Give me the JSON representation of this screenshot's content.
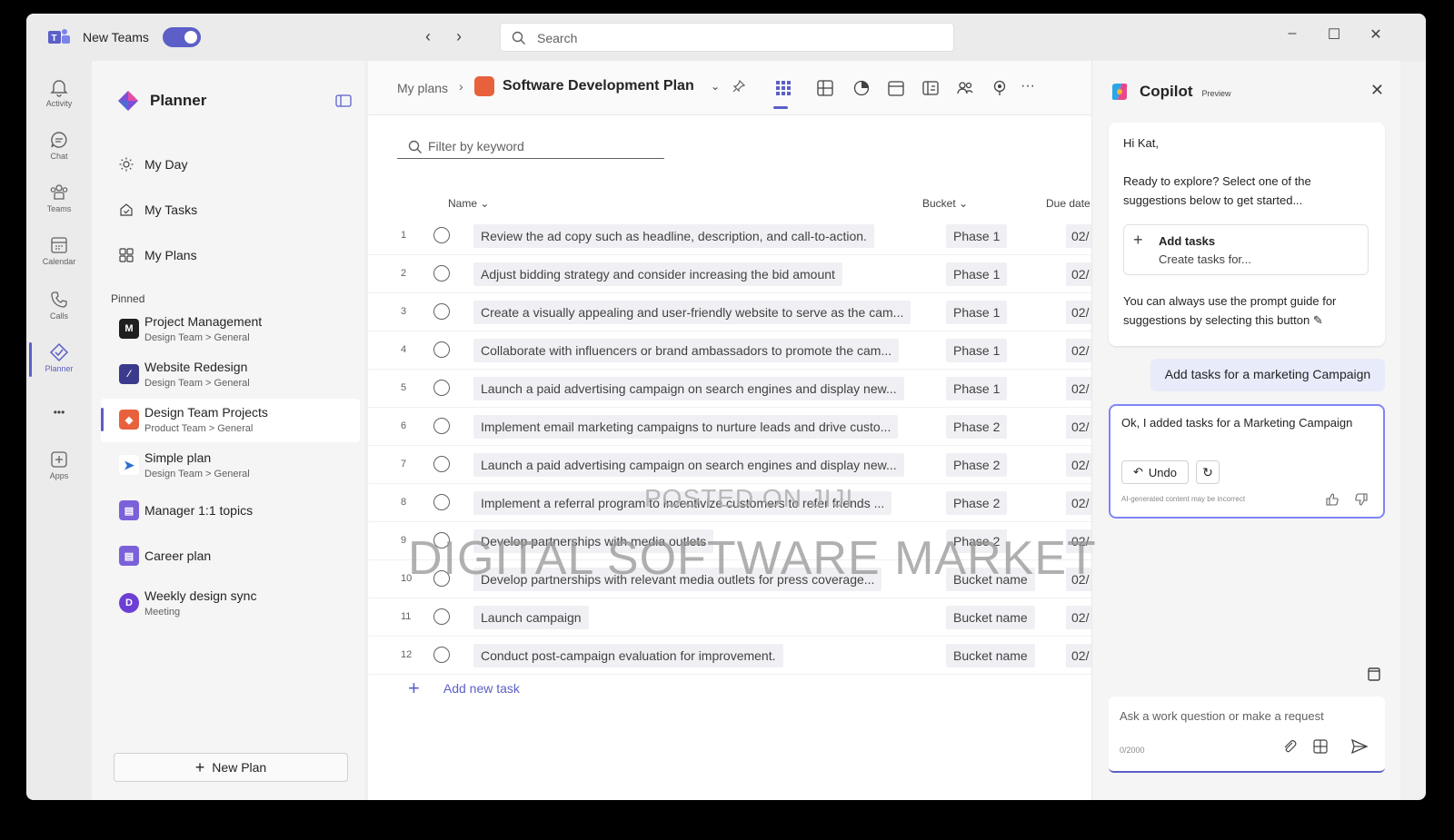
{
  "titlebar": {
    "app_name": "New Teams",
    "search_placeholder": "Search"
  },
  "rail": {
    "items": [
      {
        "label": "Activity",
        "icon": "bell-icon"
      },
      {
        "label": "Chat",
        "icon": "chat-icon"
      },
      {
        "label": "Teams",
        "icon": "teams-icon"
      },
      {
        "label": "Calendar",
        "icon": "calendar-icon"
      },
      {
        "label": "Calls",
        "icon": "phone-icon"
      },
      {
        "label": "Planner",
        "icon": "planner-icon"
      },
      {
        "label": "Apps",
        "icon": "add-app-icon"
      }
    ],
    "more": "•••"
  },
  "planner": {
    "title": "Planner",
    "nav": [
      {
        "label": "My Day",
        "icon": "sun-icon"
      },
      {
        "label": "My Tasks",
        "icon": "tasks-icon"
      },
      {
        "label": "My Plans",
        "icon": "grid-icon"
      }
    ],
    "pinned_label": "Pinned",
    "pinned": [
      {
        "name": "Project Management",
        "sub": "Design Team > General",
        "color": "#1f1f1f"
      },
      {
        "name": "Website Redesign",
        "sub": "Design Team > General",
        "color": "#3b3a8c"
      },
      {
        "name": "Design Team Projects",
        "sub": "Product Team > General",
        "color": "#e8613d"
      },
      {
        "name": "Simple plan",
        "sub": "Design Team > General",
        "color": "#2e6fd1"
      },
      {
        "name": "Manager 1:1 topics",
        "sub": "",
        "color": "#7b61d9"
      },
      {
        "name": "Career plan",
        "sub": "",
        "color": "#7b61d9"
      },
      {
        "name": "Weekly design sync",
        "sub": "Meeting",
        "color": "#6b3fd4"
      }
    ],
    "new_plan": "New Plan"
  },
  "main": {
    "breadcrumb": "My plans",
    "plan_title": "Software Development Plan",
    "filter_placeholder": "Filter by keyword",
    "columns": {
      "name": "Name",
      "bucket": "Bucket",
      "due": "Due date"
    },
    "tasks": [
      {
        "num": "1",
        "name": "Review the ad copy such as headline, description, and call-to-action.",
        "bucket": "Phase 1",
        "due": "02/"
      },
      {
        "num": "2",
        "name": "Adjust bidding strategy and consider increasing the bid amount",
        "bucket": "Phase 1",
        "due": "02/"
      },
      {
        "num": "3",
        "name": "Create a visually appealing and user-friendly website to serve as the cam...",
        "bucket": "Phase 1",
        "due": "02/"
      },
      {
        "num": "4",
        "name": "Collaborate with influencers or brand ambassadors to promote the cam...",
        "bucket": "Phase 1",
        "due": "02/"
      },
      {
        "num": "5",
        "name": "Launch a paid advertising campaign on search engines and display new...",
        "bucket": "Phase 1",
        "due": "02/"
      },
      {
        "num": "6",
        "name": "Implement email marketing campaigns to nurture leads and drive custo...",
        "bucket": "Phase 2",
        "due": "02/"
      },
      {
        "num": "7",
        "name": "Launch a paid advertising campaign on search engines and display new...",
        "bucket": "Phase 2",
        "due": "02/"
      },
      {
        "num": "8",
        "name": "Implement a referral program to incentivize customers to refer friends ...",
        "bucket": "Phase 2",
        "due": "02/"
      },
      {
        "num": "9",
        "name": "Develop partnerships with media outlets",
        "bucket": "Phase 2",
        "due": "02/"
      },
      {
        "num": "10",
        "name": "Develop partnerships with relevant media outlets for press coverage...",
        "bucket": "Bucket name",
        "due": "02/"
      },
      {
        "num": "11",
        "name": "Launch campaign",
        "bucket": "Bucket name",
        "due": "02/"
      },
      {
        "num": "12",
        "name": "Conduct post-campaign evaluation for improvement.",
        "bucket": "Bucket name",
        "due": "02/"
      }
    ],
    "add_task": "Add new task"
  },
  "copilot": {
    "title": "Copilot",
    "badge": "Preview",
    "greeting": "Hi Kat,",
    "intro": "Ready to explore? Select one of the suggestions below to get started...",
    "suggestion_title": "Add tasks",
    "suggestion_sub": "Create tasks for...",
    "guide_text": "You can always use the prompt guide for suggestions by selecting this button",
    "user_message": "Add tasks for a marketing Campaign",
    "reply": "Ok, I added tasks for a Marketing Campaign",
    "undo": "Undo",
    "disclaimer": "AI-generated content may be incorrect",
    "composer_placeholder": "Ask a work question or make a request",
    "char_count": "0/2000"
  },
  "watermark": {
    "line1": "POSTED ON JIJI",
    "line2": "DIGITAL SOFTWARE MARKET"
  },
  "colors": {
    "accent": "#5b5fc7",
    "plan_orange": "#e8613d"
  }
}
